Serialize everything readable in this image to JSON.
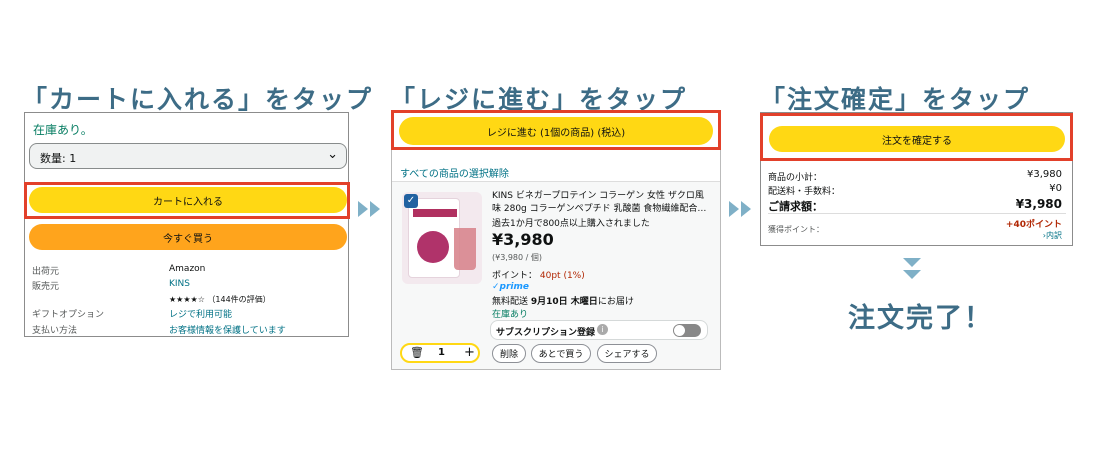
{
  "steps": {
    "step1_title": "「カートに入れる」をタップ",
    "step2_title": "「レジに進む」をタップ",
    "step3_title": "「注文確定」をタップ",
    "done_text": "注文完了！"
  },
  "panel1": {
    "stock": "在庫あり。",
    "quantity": "数量: 1",
    "add_to_cart": "カートに入れる",
    "buy_now": "今すぐ買う",
    "rows": [
      {
        "label": "出荷元",
        "value": "Amazon"
      },
      {
        "label": "販売元",
        "value": "KINS"
      },
      {
        "label": "",
        "value": "★★★★☆ （144件の評価）"
      },
      {
        "label": "ギフトオプション",
        "value": "レジで利用可能"
      },
      {
        "label": "支払い方法",
        "value": "お客様情報を保護しています"
      }
    ]
  },
  "panel2": {
    "proceed": "レジに進む (1個の商品) (税込)",
    "deselect": "すべての商品の選択解除",
    "product_title": "KINS ビネガープロテイン コラーゲン 女性 ザクロ風味 280g コラーゲンペプチド 乳酸菌 食物繊維配合…",
    "purchase_note": "過去1か月で800点以上購入されました",
    "price": "¥3,980",
    "unit_price": "(¥3,980 / 個)",
    "points_label": "ポイント：",
    "points_value": "40pt (1%)",
    "prime": "prime",
    "delivery_prefix": "無料配送",
    "delivery_date": "9月10日 木曜日",
    "delivery_suffix": "にお届け",
    "in_stock": "在庫あり",
    "subscription": "サブスクリプション登録",
    "qty": "1",
    "delete": "削除",
    "later": "あとで買う",
    "share": "シェアする"
  },
  "panel3": {
    "confirm": "注文を確定する",
    "subtotal_label": "商品の小計：",
    "subtotal_value": "¥3,980",
    "shipping_label": "配送料・手数料：",
    "shipping_value": "¥0",
    "total_label": "ご請求額：",
    "total_value": "¥3,980",
    "points_earned": "+40ポイント",
    "points_label": "獲得ポイント：",
    "breakdown": "›内訳"
  },
  "colors": {
    "title": "#3d6c86",
    "highlight": "#e2402a",
    "yellow_button": "#ffd814",
    "orange_button": "#ffa41c",
    "link": "#007185",
    "arrow": "#7fb0c7"
  }
}
